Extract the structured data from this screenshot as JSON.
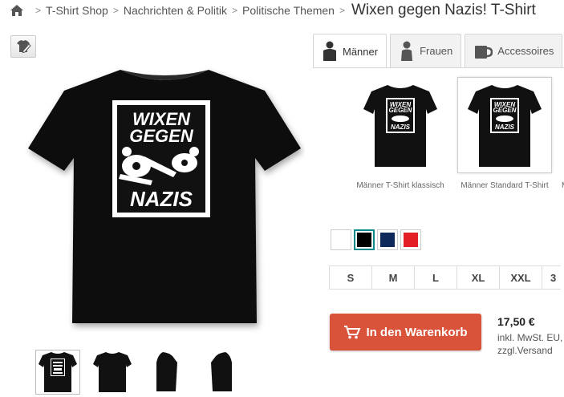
{
  "breadcrumb": {
    "items": [
      "T-Shirt Shop",
      "Nachrichten & Politik",
      "Politische Themen"
    ],
    "current": "Wixen gegen Nazis! T-Shirt",
    "separator": ">"
  },
  "design": {
    "line1": "WIXEN",
    "line2": "GEGEN",
    "line3": "NAZIS"
  },
  "tabs": [
    {
      "label": "Männer",
      "icon": "man-icon",
      "active": true
    },
    {
      "label": "Frauen",
      "icon": "woman-icon",
      "active": false
    },
    {
      "label": "Accessoires",
      "icon": "mug-icon",
      "active": false
    }
  ],
  "product_types": [
    {
      "label": "Männer T-Shirt klassisch"
    },
    {
      "label": "Männer Standard T-Shirt",
      "selected": true
    },
    {
      "label": "Mä"
    }
  ],
  "colors": [
    {
      "name": "white",
      "hex": "#ffffff"
    },
    {
      "name": "black",
      "hex": "#000000",
      "selected": true
    },
    {
      "name": "navy",
      "hex": "#0f2a5a"
    },
    {
      "name": "red",
      "hex": "#e31e24"
    }
  ],
  "sizes": [
    "S",
    "M",
    "L",
    "XL",
    "XXL",
    "3"
  ],
  "cart": {
    "label": "In den Warenkorb",
    "icon": "cart-icon",
    "color": "#d9533a"
  },
  "price": {
    "amount": "17,50 €",
    "tax_note": "inkl. MwSt. EU,",
    "shipping_note": "zzgl.Versand"
  },
  "accent_color": "#0a8a8a"
}
